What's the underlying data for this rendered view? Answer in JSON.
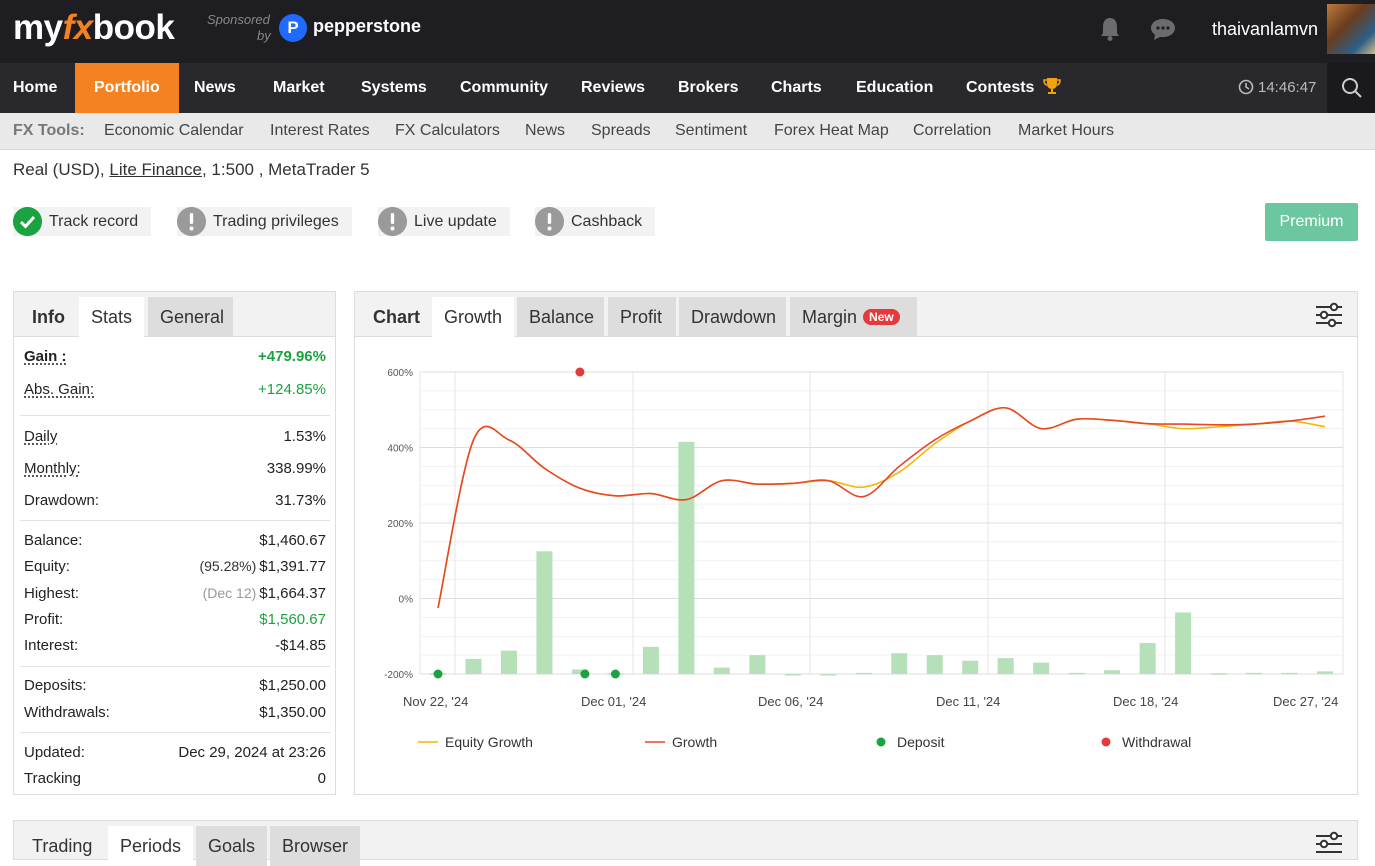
{
  "header": {
    "logo_my": "my",
    "logo_fx": "fx",
    "logo_book": "book",
    "sponsored_line1": "Sponsored",
    "sponsored_line2": "by",
    "sponsor_name": "pepperstone",
    "username": "thaivanlamvn"
  },
  "nav": {
    "items": [
      "Home",
      "Portfolio",
      "News",
      "Market",
      "Systems",
      "Community",
      "Reviews",
      "Brokers",
      "Charts",
      "Education",
      "Contests"
    ],
    "active": "Portfolio",
    "time": "14:46:47"
  },
  "tools": {
    "label": "FX Tools:",
    "items": [
      "Economic Calendar",
      "Interest Rates",
      "FX Calculators",
      "News",
      "Spreads",
      "Sentiment",
      "Forex Heat Map",
      "Correlation",
      "Market Hours"
    ]
  },
  "account": {
    "prefix": "Real (USD), ",
    "broker": "Lite Finance",
    "suffix": ", 1:500 , MetaTrader 5"
  },
  "badges": [
    {
      "label": "Track record",
      "status": "ok"
    },
    {
      "label": "Trading privileges",
      "status": "warn"
    },
    {
      "label": "Live update",
      "status": "warn"
    },
    {
      "label": "Cashback",
      "status": "warn"
    }
  ],
  "premium_label": "Premium",
  "stats_tabs": [
    "Info",
    "Stats",
    "General"
  ],
  "stats": {
    "gain_label": "Gain :",
    "gain": "+479.96%",
    "abs_gain_label": "Abs. Gain:",
    "abs_gain": "+124.85%",
    "daily_label": "Daily",
    "daily": "1.53%",
    "monthly_label": "Monthly:",
    "monthly": "338.99%",
    "drawdown_label": "Drawdown:",
    "drawdown": "31.73%",
    "balance_label": "Balance:",
    "balance": "$1,460.67",
    "equity_label": "Equity:",
    "equity_pct": "(95.28%)",
    "equity": "$1,391.77",
    "highest_label": "Highest:",
    "highest_date": "(Dec 12)",
    "highest": "$1,664.37",
    "profit_label": "Profit:",
    "profit": "$1,560.67",
    "interest_label": "Interest:",
    "interest": "-$14.85",
    "deposits_label": "Deposits:",
    "deposits": "$1,250.00",
    "withdrawals_label": "Withdrawals:",
    "withdrawals": "$1,350.00",
    "updated_label": "Updated:",
    "updated": "Dec 29, 2024 at 23:26",
    "tracking_label": "Tracking",
    "tracking": "0"
  },
  "chart_tabs": {
    "title": "Chart",
    "items": [
      "Growth",
      "Balance",
      "Profit",
      "Drawdown",
      "Margin"
    ],
    "active": "Growth",
    "new_badge": "New"
  },
  "chart_data": {
    "type": "line",
    "y_ticks": [
      "600%",
      "400%",
      "200%",
      "0%",
      "-200%"
    ],
    "ylim": [
      -200,
      600
    ],
    "x_tick_labels": [
      "Nov 22, '24",
      "Dec 01, '24",
      "Dec 06, '24",
      "Dec 11, '24",
      "Dec 18, '24",
      "Dec 27, '24"
    ],
    "grid": true,
    "legend_position": "bottom",
    "series": [
      {
        "name": "Equity Growth",
        "color": "#f2b705",
        "x": [
          0,
          1,
          2,
          3,
          4,
          5,
          6,
          7,
          8,
          9,
          10,
          11,
          12,
          13,
          14,
          15,
          16,
          17,
          18,
          19,
          20,
          21,
          22,
          23,
          24,
          25
        ],
        "values": [
          -25,
          420,
          420,
          345,
          292,
          272,
          278,
          262,
          312,
          303,
          305,
          312,
          295,
          335,
          410,
          470,
          505,
          450,
          475,
          472,
          463,
          450,
          455,
          462,
          470,
          455
        ]
      },
      {
        "name": "Growth",
        "color": "#e8462a",
        "x": [
          0,
          1,
          2,
          3,
          4,
          5,
          6,
          7,
          8,
          9,
          10,
          11,
          12,
          13,
          14,
          15,
          16,
          17,
          18,
          19,
          20,
          21,
          22,
          23,
          24,
          25
        ],
        "values": [
          -25,
          420,
          420,
          345,
          292,
          272,
          278,
          262,
          312,
          303,
          305,
          312,
          270,
          350,
          420,
          470,
          505,
          450,
          475,
          472,
          463,
          462,
          460,
          462,
          470,
          483
        ]
      },
      {
        "name": "Profit",
        "type": "bar",
        "color": "#b5e0b8",
        "x": [
          0,
          1,
          2,
          3,
          4,
          5,
          6,
          7,
          8,
          9,
          10,
          11,
          12,
          13,
          14,
          15,
          16,
          17,
          18,
          19,
          20,
          21,
          22,
          23,
          24,
          25
        ],
        "values": [
          -198,
          -160,
          -138,
          125,
          -188,
          -198,
          -128,
          415,
          -183,
          -150,
          -200,
          -200,
          -197,
          -145,
          -150,
          -165,
          -158,
          -170,
          -197,
          -190,
          -118,
          -37,
          -198,
          -197,
          -197,
          -193
        ]
      }
    ],
    "deposits": [
      {
        "x": 0,
        "y": -200
      },
      {
        "x": 4,
        "y": -200
      },
      {
        "x": 5,
        "y": -200
      }
    ],
    "withdrawals": [
      {
        "x": 4,
        "y": 600
      }
    ],
    "legend": [
      {
        "label": "Equity Growth",
        "kind": "line",
        "color": "#f2b705"
      },
      {
        "label": "Growth",
        "kind": "line",
        "color": "#e8462a"
      },
      {
        "label": "Deposit",
        "kind": "dot",
        "color": "#1aa340"
      },
      {
        "label": "Withdrawal",
        "kind": "dot",
        "color": "#e5393b"
      }
    ]
  },
  "bottom_tabs": [
    "Trading",
    "Periods",
    "Goals",
    "Browser"
  ]
}
